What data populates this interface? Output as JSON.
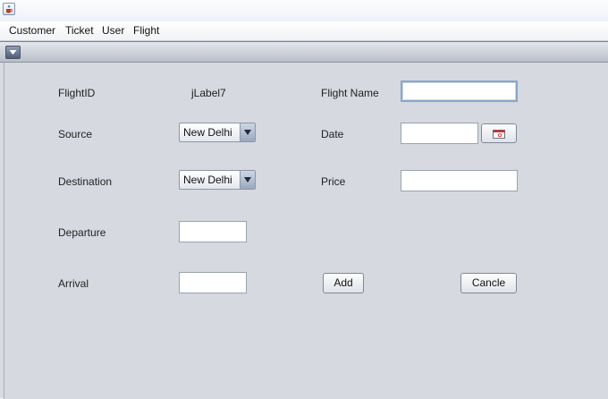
{
  "menu": {
    "items": [
      "Customer",
      "Ticket",
      "User",
      "Flight"
    ]
  },
  "form": {
    "flight_id_label": "FlightID",
    "flight_id_value": "jLabel7",
    "flight_name_label": "Flight Name",
    "flight_name_value": "",
    "source_label": "Source",
    "source_selected": "New Delhi",
    "date_label": "Date",
    "date_value": "",
    "destination_label": "Destination",
    "destination_selected": "New Delhi",
    "price_label": "Price",
    "price_value": "",
    "departure_label": "Departure",
    "departure_value": "",
    "arrival_label": "Arrival",
    "arrival_value": "",
    "add_label": "Add",
    "cancel_label": "Cancle"
  },
  "icons": {
    "app": "java-cup-icon",
    "frame_menu": "chevron-down-icon",
    "combo_arrow": "triangle-down-icon",
    "calendar": "calendar-icon"
  },
  "colors": {
    "content_bg": "#d6d9df",
    "focus_border": "#8aa7c8"
  }
}
